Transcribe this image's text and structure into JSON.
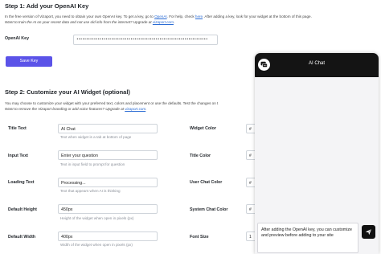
{
  "step1": {
    "title": "Step 1: Add your OpenAI Key",
    "text_line1_a": "In the free version of Vizaport, you need to obtain your own OpenAI key. To get a key, go to ",
    "link_openai": "OpenAI",
    "text_line1_b": ". For help, check ",
    "link_here": "here",
    "text_line1_c": ". After adding a key, look for your widget at the bottom of this page.",
    "text_line2_a": "Want to train the AI on your recent data and not use old info from the internet? Upgrade at ",
    "link_vizaport": "vizaport.com",
    "text_line2_b": ".",
    "key_label": "OpenAI Key",
    "key_value": "••••••••••••••••••••••••••••••••••••••••••••••••••••••••••••••••••••",
    "save_label": "Save Key"
  },
  "step2": {
    "title": "Step 2: Customize your AI Widget (optional)",
    "text_line1": "You may choose to customize your widget with your preferred text, colors and placement or use the defaults. Test the changes on t",
    "text_line2_a": "Want to remove the Vizaport branding or add voice features? Upgrade at ",
    "link_vizaport": "vizaport.com",
    "text_line2_b": ".",
    "fields": {
      "title_text": {
        "label": "Title Text",
        "value": "AI Chat",
        "hint": "Text when widget is a tab at bottom of page"
      },
      "input_text": {
        "label": "Input Text",
        "value": "Enter your question",
        "hint": "Text in input field to prompt for question"
      },
      "loading_text": {
        "label": "Loading Text",
        "value": "Processing...",
        "hint": "Text that appears when AI is thinking"
      },
      "default_height": {
        "label": "Default Height",
        "value": "450px",
        "hint": "Height of the widget when open in pixels (px)"
      },
      "default_width": {
        "label": "Default Width",
        "value": "400px",
        "hint": "Width of the widget when open in pixels (px)"
      },
      "widget_color": {
        "label": "Widget Color",
        "value": "#"
      },
      "title_color": {
        "label": "Title Color",
        "value": "#"
      },
      "user_chat_color": {
        "label": "User Chat Color",
        "value": "#"
      },
      "system_chat_color": {
        "label": "System Chat Color",
        "value": "#"
      },
      "font_size": {
        "label": "Font Size",
        "value": "1"
      }
    }
  },
  "chat": {
    "title": "AI Chat",
    "input_value": "After adding the OpenAI key, you can customize and preview before adding to your site",
    "colors": {
      "header": "#141414",
      "body": "#f4f4f6",
      "send": "#111111"
    }
  },
  "colors": {
    "accent": "#5b53e8",
    "link": "#2b6cd4"
  }
}
